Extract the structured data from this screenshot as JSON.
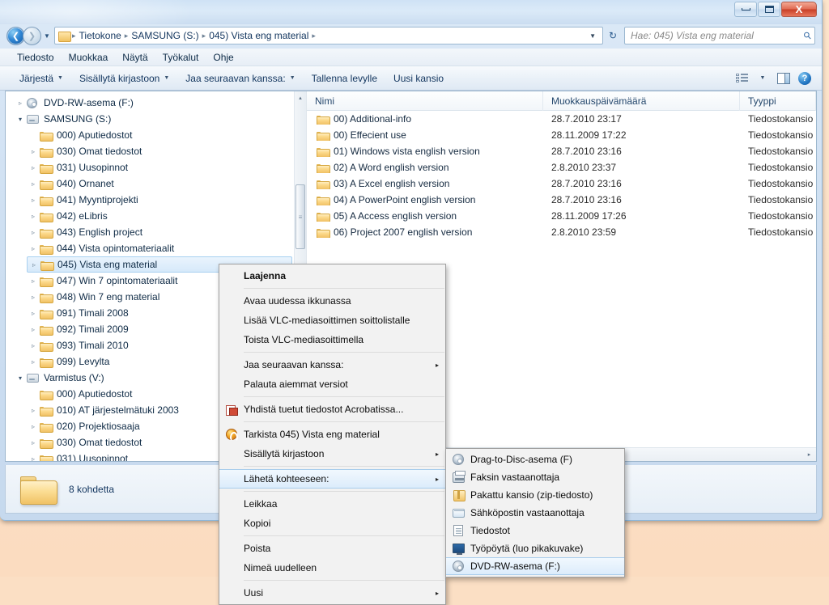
{
  "window": {
    "controls": {
      "minimize": "Pienennä",
      "maximize": "Suurenna",
      "close": "X"
    }
  },
  "address": {
    "back_icon": "back-arrow-icon",
    "forward_icon": "forward-arrow-icon",
    "recent_icon": "chevron-down-icon",
    "folder_icon": "folder-icon",
    "crumbs": [
      "Tietokone",
      "SAMSUNG (S:)",
      "045) Vista eng material"
    ],
    "separator": "▸",
    "dropdown": "▼",
    "refresh_icon": "refresh-icon",
    "refresh_glyph": "↻"
  },
  "search": {
    "placeholder": "Hae: 045) Vista eng material",
    "value": "",
    "icon": "search-icon"
  },
  "menubar": {
    "items": [
      "Tiedosto",
      "Muokkaa",
      "Näytä",
      "Työkalut",
      "Ohje"
    ]
  },
  "toolbar": {
    "items": [
      {
        "label": "Järjestä",
        "has_caret": true
      },
      {
        "label": "Sisällytä kirjastoon",
        "has_caret": true
      },
      {
        "label": "Jaa seuraavan kanssa:",
        "has_caret": true
      },
      {
        "label": "Tallenna levylle",
        "has_caret": false
      },
      {
        "label": "Uusi kansio",
        "has_caret": false
      }
    ],
    "caret": "▼",
    "view_icon": "view-layout-icon",
    "view_caret": "▼",
    "preview_pane_icon": "preview-pane-icon",
    "help_icon": "help-icon",
    "help_glyph": "?"
  },
  "nav_tree": {
    "items": [
      {
        "label": "DVD-RW-asema (F:)",
        "icon": "disc-icon",
        "expander": "▹",
        "indent": 1,
        "selected": false
      },
      {
        "label": "SAMSUNG (S:)",
        "icon": "drive-icon",
        "expander": "▾",
        "indent": 1,
        "selected": false
      },
      {
        "label": "000) Aputiedostot",
        "icon": "folder-icon",
        "expander": "",
        "indent": 2,
        "selected": false
      },
      {
        "label": "030) Omat tiedostot",
        "icon": "folder-icon",
        "expander": "▹",
        "indent": 2,
        "selected": false
      },
      {
        "label": "031) Uusopinnot",
        "icon": "folder-icon",
        "expander": "▹",
        "indent": 2,
        "selected": false
      },
      {
        "label": "040) Ornanet",
        "icon": "folder-icon",
        "expander": "▹",
        "indent": 2,
        "selected": false
      },
      {
        "label": "041) Myyntiprojekti",
        "icon": "folder-icon",
        "expander": "▹",
        "indent": 2,
        "selected": false
      },
      {
        "label": "042) eLibris",
        "icon": "folder-icon",
        "expander": "▹",
        "indent": 2,
        "selected": false
      },
      {
        "label": "043) English project",
        "icon": "folder-icon",
        "expander": "▹",
        "indent": 2,
        "selected": false
      },
      {
        "label": "044) Vista opintomateriaalit",
        "icon": "folder-icon",
        "expander": "▹",
        "indent": 2,
        "selected": false
      },
      {
        "label": "045) Vista eng material",
        "icon": "folder-icon",
        "expander": "▹",
        "indent": 2,
        "selected": true
      },
      {
        "label": "047) Win 7 opintomateriaalit",
        "icon": "folder-icon",
        "expander": "▹",
        "indent": 2,
        "selected": false
      },
      {
        "label": "048) Win 7 eng material",
        "icon": "folder-icon",
        "expander": "▹",
        "indent": 2,
        "selected": false
      },
      {
        "label": "091) Timali 2008",
        "icon": "folder-icon",
        "expander": "▹",
        "indent": 2,
        "selected": false
      },
      {
        "label": "092) Timali 2009",
        "icon": "folder-icon",
        "expander": "▹",
        "indent": 2,
        "selected": false
      },
      {
        "label": "093) Timali 2010",
        "icon": "folder-icon",
        "expander": "▹",
        "indent": 2,
        "selected": false
      },
      {
        "label": "099) Levylta",
        "icon": "folder-icon",
        "expander": "▹",
        "indent": 2,
        "selected": false
      },
      {
        "label": "Varmistus (V:)",
        "icon": "drive-icon",
        "expander": "▾",
        "indent": 1,
        "selected": false
      },
      {
        "label": "000) Aputiedostot",
        "icon": "folder-icon",
        "expander": "",
        "indent": 2,
        "selected": false
      },
      {
        "label": "010) AT järjestelmätuki 2003",
        "icon": "folder-icon",
        "expander": "▹",
        "indent": 2,
        "selected": false
      },
      {
        "label": "020) Projektiosaaja",
        "icon": "folder-icon",
        "expander": "▹",
        "indent": 2,
        "selected": false
      },
      {
        "label": "030) Omat tiedostot",
        "icon": "folder-icon",
        "expander": "▹",
        "indent": 2,
        "selected": false
      },
      {
        "label": "031) Uusopinnot",
        "icon": "folder-icon",
        "expander": "▹",
        "indent": 2,
        "selected": false
      }
    ],
    "scroll_up": "▴",
    "scroll_down": "▾",
    "thumb_grip": "≡"
  },
  "file_list": {
    "columns": [
      "Nimi",
      "Muokkauspäivämäärä",
      "Tyyppi"
    ],
    "rows": [
      {
        "name": "00) Additional-info",
        "modified": "28.7.2010 23:17",
        "type": "Tiedostokansio"
      },
      {
        "name": "00) Effecient use",
        "modified": "28.11.2009 17:22",
        "type": "Tiedostokansio"
      },
      {
        "name": "01) Windows vista english version",
        "modified": "28.7.2010 23:16",
        "type": "Tiedostokansio"
      },
      {
        "name": "02) A Word english version",
        "modified": "2.8.2010 23:37",
        "type": "Tiedostokansio"
      },
      {
        "name": "03) A Excel english version",
        "modified": "28.7.2010 23:16",
        "type": "Tiedostokansio"
      },
      {
        "name": "04) A PowerPoint english version",
        "modified": "28.7.2010 23:16",
        "type": "Tiedostokansio"
      },
      {
        "name": "05) A Access english version",
        "modified": "28.11.2009 17:26",
        "type": "Tiedostokansio"
      },
      {
        "name": "06) Project 2007 english version",
        "modified": "2.8.2010 23:59",
        "type": "Tiedostokansio"
      }
    ],
    "hscroll_left": "◂",
    "hscroll_right": "▸"
  },
  "details_pane": {
    "folder_icon": "large-folder-icon",
    "item_count": "8 kohdetta"
  },
  "context_menu": {
    "items": [
      {
        "label": "Laajenna",
        "bold": true,
        "icon": "",
        "arrow": "",
        "sep_after": true,
        "highlighted": false
      },
      {
        "label": "Avaa uudessa ikkunassa",
        "bold": false,
        "icon": "",
        "arrow": "",
        "sep_after": false,
        "highlighted": false
      },
      {
        "label": "Lisää VLC-mediasoittimen soittolistalle",
        "bold": false,
        "icon": "",
        "arrow": "",
        "sep_after": false,
        "highlighted": false
      },
      {
        "label": "Toista VLC-mediasoittimella",
        "bold": false,
        "icon": "",
        "arrow": "",
        "sep_after": true,
        "highlighted": false
      },
      {
        "label": "Jaa seuraavan kanssa:",
        "bold": false,
        "icon": "",
        "arrow": "▸",
        "sep_after": false,
        "highlighted": false
      },
      {
        "label": "Palauta aiemmat versiot",
        "bold": false,
        "icon": "",
        "arrow": "",
        "sep_after": true,
        "highlighted": false
      },
      {
        "label": "Yhdistä tuetut tiedostot Acrobatissa...",
        "bold": false,
        "icon": "acrobat-icon",
        "arrow": "",
        "sep_after": true,
        "highlighted": false
      },
      {
        "label": "Tarkista 045) Vista eng material",
        "bold": false,
        "icon": "antivirus-icon",
        "arrow": "",
        "sep_after": false,
        "highlighted": false
      },
      {
        "label": "Sisällytä kirjastoon",
        "bold": false,
        "icon": "",
        "arrow": "▸",
        "sep_after": true,
        "highlighted": false
      },
      {
        "label": "Lähetä kohteeseen:",
        "bold": false,
        "icon": "",
        "arrow": "▸",
        "sep_after": true,
        "highlighted": true
      },
      {
        "label": "Leikkaa",
        "bold": false,
        "icon": "",
        "arrow": "",
        "sep_after": false,
        "highlighted": false
      },
      {
        "label": "Kopioi",
        "bold": false,
        "icon": "",
        "arrow": "",
        "sep_after": true,
        "highlighted": false
      },
      {
        "label": "Poista",
        "bold": false,
        "icon": "",
        "arrow": "",
        "sep_after": false,
        "highlighted": false
      },
      {
        "label": "Nimeä uudelleen",
        "bold": false,
        "icon": "",
        "arrow": "",
        "sep_after": true,
        "highlighted": false
      },
      {
        "label": "Uusi",
        "bold": false,
        "icon": "",
        "arrow": "▸",
        "sep_after": false,
        "highlighted": false
      }
    ]
  },
  "send_to_submenu": {
    "items": [
      {
        "label": "Drag-to-Disc-asema (F)",
        "icon": "disc-icon",
        "highlighted": false
      },
      {
        "label": "Faksin vastaanottaja",
        "icon": "fax-icon",
        "highlighted": false
      },
      {
        "label": "Pakattu kansio (zip-tiedosto)",
        "icon": "zip-folder-icon",
        "highlighted": false
      },
      {
        "label": "Sähköpostin vastaanottaja",
        "icon": "mail-icon",
        "highlighted": false
      },
      {
        "label": "Tiedostot",
        "icon": "document-icon",
        "highlighted": false
      },
      {
        "label": "Työpöytä (luo pikakuvake)",
        "icon": "desktop-icon",
        "highlighted": false
      },
      {
        "label": "DVD-RW-asema (F:)",
        "icon": "disc-icon",
        "highlighted": true
      }
    ]
  },
  "colors": {
    "accent": "#2f86d4",
    "selection": "#d6e9fa",
    "close_button": "#c73f27",
    "folder": "#f0c164"
  }
}
